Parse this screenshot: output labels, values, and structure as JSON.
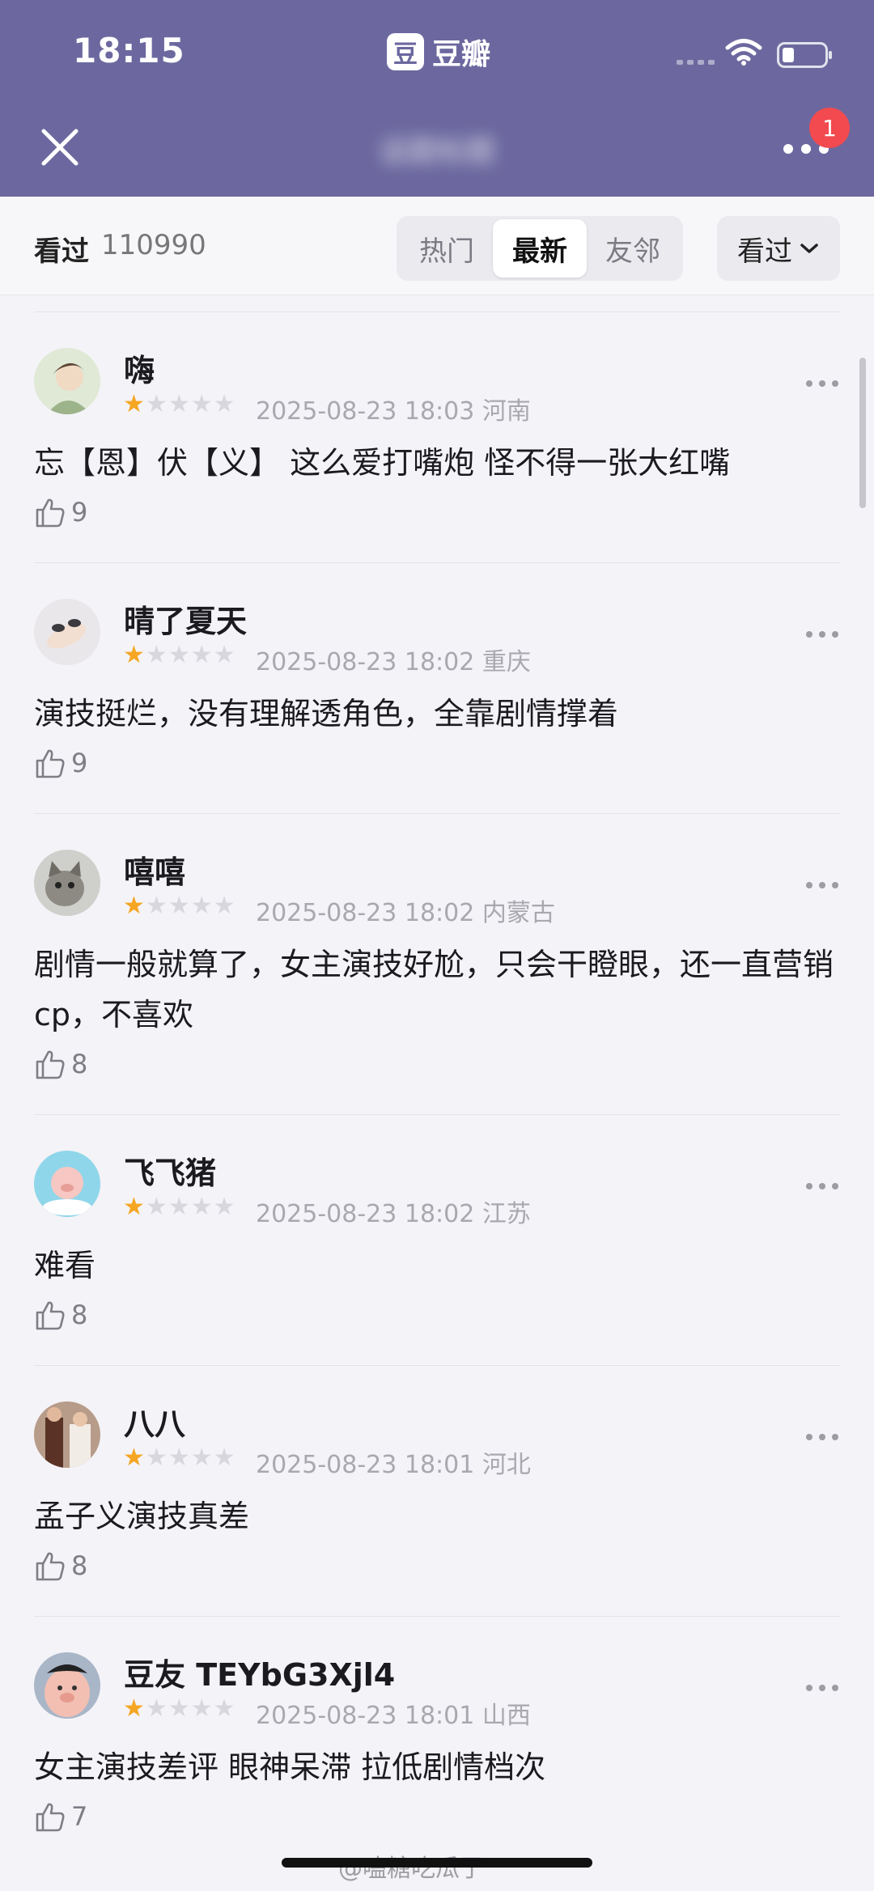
{
  "status_bar": {
    "time": "18:15",
    "app_name": "豆瓣",
    "app_logo_char": "豆"
  },
  "nav": {
    "title": "话题标题",
    "badge_count": "1",
    "close_icon": "close-icon",
    "more_icon": "more-dots-icon"
  },
  "filter": {
    "seen_label": "看过",
    "seen_count": "110990",
    "tabs": [
      {
        "label": "热门",
        "active": false
      },
      {
        "label": "最新",
        "active": true
      },
      {
        "label": "友邻",
        "active": false
      }
    ],
    "dropdown_label": "看过"
  },
  "colors": {
    "header": "#6c689f",
    "star_on": "#f5a623",
    "star_off": "#d8d7dd",
    "badge": "#f24a4f"
  },
  "reviews": [
    {
      "name": "嗨",
      "rating": 1,
      "date": "2025-08-23 18:03",
      "region": "河南",
      "text": "忘【恩】伏【义】   这么爱打嘴炮  怪不得一张大红嘴",
      "likes": "9"
    },
    {
      "name": "晴了夏天",
      "rating": 1,
      "date": "2025-08-23 18:02",
      "region": "重庆",
      "text": "演技挺烂，没有理解透角色，全靠剧情撑着",
      "likes": "9"
    },
    {
      "name": "嘻嘻",
      "rating": 1,
      "date": "2025-08-23 18:02",
      "region": "内蒙古",
      "text": "剧情一般就算了，女主演技好尬，只会干瞪眼，还一直营销 cp，不喜欢",
      "likes": "8"
    },
    {
      "name": "飞飞猪",
      "rating": 1,
      "date": "2025-08-23 18:02",
      "region": "江苏",
      "text": "难看",
      "likes": "8"
    },
    {
      "name": "八八",
      "rating": 1,
      "date": "2025-08-23 18:01",
      "region": "河北",
      "text": "孟子义演技真差",
      "likes": "8"
    },
    {
      "name": "豆友 TEYbG3Xjl4",
      "rating": 1,
      "date": "2025-08-23 18:01",
      "region": "山西",
      "text": "女主演技差评 眼神呆滞 拉低剧情档次",
      "likes": "7"
    }
  ],
  "watermark": "@嗑糖吃瓜了"
}
